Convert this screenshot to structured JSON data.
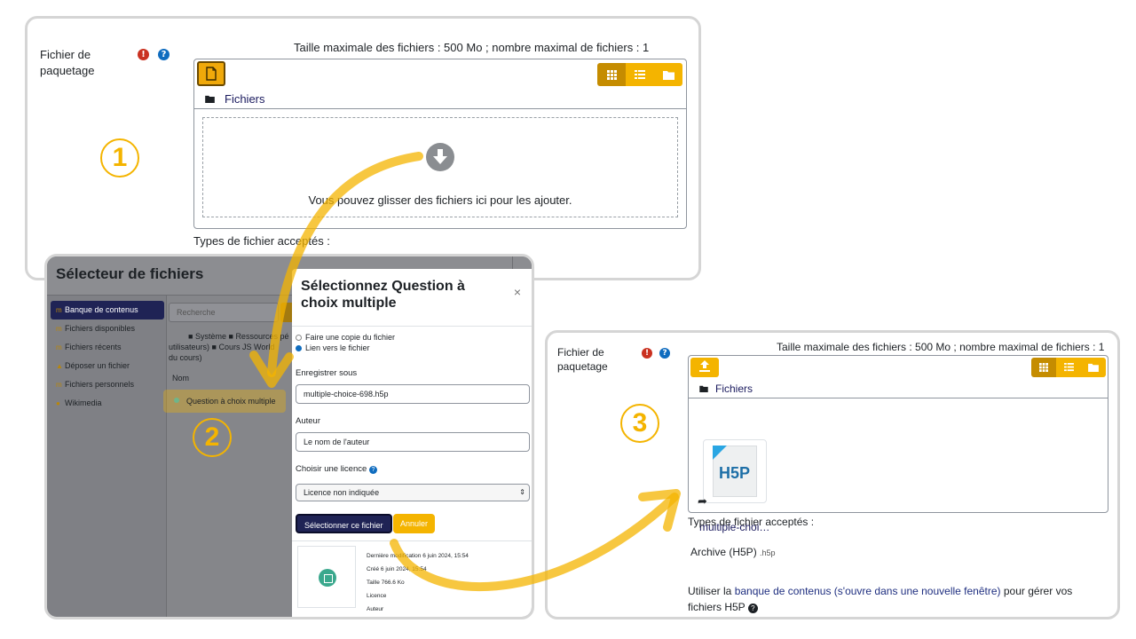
{
  "panel1": {
    "field_label_line1": "Fichier de",
    "field_label_line2": "paquetage",
    "required_icon": "!",
    "help_icon": "?",
    "max_info": "Taille maximale des fichiers : 500 Mo ; nombre maximal de fichiers : 1",
    "path_label": "Fichiers",
    "drop_text": "Vous pouvez glisser des fichiers ici pour les ajouter.",
    "accepted_label": "Types de fichier acceptés :",
    "step": "1"
  },
  "panel2": {
    "dialog_title": "Sélecteur de fichiers",
    "repositories": [
      {
        "label": "Banque de contenus",
        "icon": "content-bank-icon"
      },
      {
        "label": "Fichiers disponibles",
        "icon": "server-files-icon"
      },
      {
        "label": "Fichiers récents",
        "icon": "recent-files-icon"
      },
      {
        "label": "Déposer un fichier",
        "icon": "upload-icon"
      },
      {
        "label": "Fichiers personnels",
        "icon": "private-files-icon"
      },
      {
        "label": "Wikimedia",
        "icon": "wikimedia-icon"
      }
    ],
    "search_placeholder": "Recherche",
    "breadcrumb": {
      "root": "Système",
      "part2": "Ressources pé",
      "part3": "utilisateurs)",
      "part4": "Cours JS World",
      "part5": "du cours)"
    },
    "column_header": "Nom",
    "file_name": "Question à choix multiple",
    "step": "2",
    "modal": {
      "title": "Sélectionnez Question à choix multiple",
      "close": "×",
      "radio_copy": "Faire une copie du fichier",
      "radio_link": "Lien vers le fichier",
      "save_as_label": "Enregistrer sous",
      "save_as_value": "multiple-choice-698.h5p",
      "author_label": "Auteur",
      "author_value": "Le nom de l'auteur",
      "license_label": "Choisir une licence",
      "license_value": "Licence non indiquée",
      "select_button": "Sélectionner ce fichier",
      "cancel_button": "Annuler",
      "meta_modified": "Dernière modification 6 juin 2024, 15:54",
      "meta_created": "Créé 6 juin 2024, 15:54",
      "meta_size": "Taille 766.6 Ko",
      "meta_license": "Licence",
      "meta_author": "Auteur"
    }
  },
  "panel3": {
    "field_label_line1": "Fichier de",
    "field_label_line2": "paquetage",
    "max_info": "Taille maximale des fichiers : 500 Mo ; nombre maximal de fichiers : 1",
    "path_label": "Fichiers",
    "file_logo": "H5P",
    "file_name": "multiple-choi…",
    "accepted_label": "Types de fichier acceptés :",
    "accepted_type": "Archive (H5P)",
    "accepted_ext": ".h5p",
    "note_before": "Utiliser la ",
    "note_link": "banque de contenus (s'ouvre dans une nouvelle fenêtre)",
    "note_after": " pour gérer vos",
    "note_line2": "fichiers H5P",
    "step": "3"
  },
  "colors": {
    "accent": "#f4b400",
    "primary": "#1f2355",
    "required": "#ca3120",
    "help": "#0f6cbf"
  }
}
